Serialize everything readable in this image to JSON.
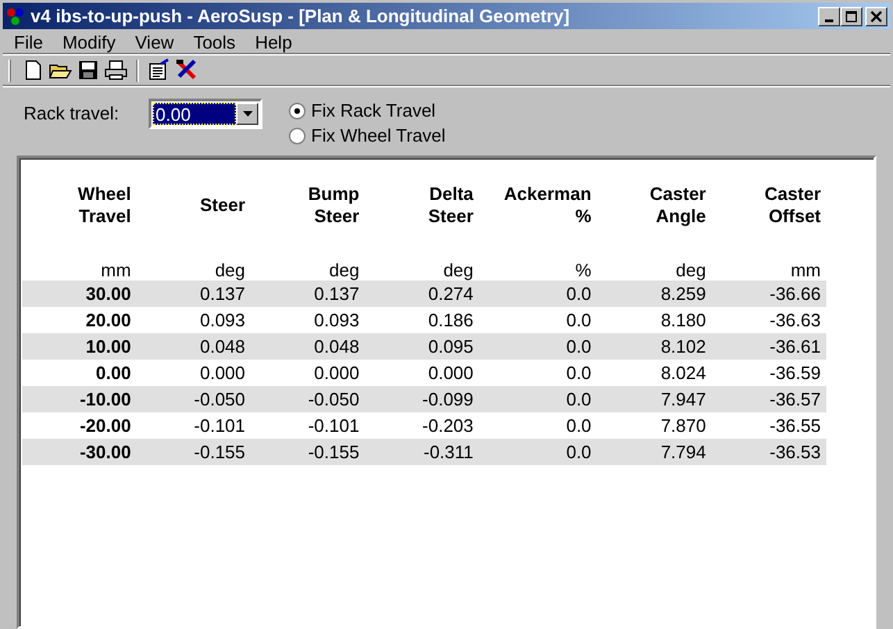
{
  "window": {
    "title": "v4 ibs-to-up-push - AeroSusp - [Plan & Longitudinal Geometry]"
  },
  "menu": [
    "File",
    "Modify",
    "View",
    "Tools",
    "Help"
  ],
  "toolbar": [
    {
      "kind": "new"
    },
    {
      "kind": "open"
    },
    {
      "kind": "save"
    },
    {
      "kind": "print"
    },
    {
      "kind": "separator"
    },
    {
      "kind": "properties"
    },
    {
      "kind": "tools"
    }
  ],
  "rack_travel": {
    "label": "Rack travel:",
    "value": "0.00"
  },
  "fix_options": [
    {
      "label": "Fix Rack Travel",
      "selected": true
    },
    {
      "label": "Fix Wheel Travel",
      "selected": false
    }
  ],
  "table": {
    "columns": [
      {
        "heading": [
          "Wheel",
          "Travel"
        ],
        "unit": "mm"
      },
      {
        "heading": [
          "Steer"
        ],
        "unit": "deg"
      },
      {
        "heading": [
          "Bump",
          "Steer"
        ],
        "unit": "deg"
      },
      {
        "heading": [
          "Delta",
          "Steer"
        ],
        "unit": "deg"
      },
      {
        "heading": [
          "Ackerman",
          "%"
        ],
        "unit": "%"
      },
      {
        "heading": [
          "Caster",
          "Angle"
        ],
        "unit": "deg"
      },
      {
        "heading": [
          "Caster",
          "Offset"
        ],
        "unit": "mm"
      }
    ],
    "rows": [
      [
        "30.00",
        "0.137",
        "0.137",
        "0.274",
        "0.0",
        "8.259",
        "-36.66"
      ],
      [
        "20.00",
        "0.093",
        "0.093",
        "0.186",
        "0.0",
        "8.180",
        "-36.63"
      ],
      [
        "10.00",
        "0.048",
        "0.048",
        "0.095",
        "0.0",
        "8.102",
        "-36.61"
      ],
      [
        "0.00",
        "0.000",
        "0.000",
        "0.000",
        "0.0",
        "8.024",
        "-36.59"
      ],
      [
        "-10.00",
        "-0.050",
        "-0.050",
        "-0.099",
        "0.0",
        "7.947",
        "-36.57"
      ],
      [
        "-20.00",
        "-0.101",
        "-0.101",
        "-0.203",
        "0.0",
        "7.870",
        "-36.55"
      ],
      [
        "-30.00",
        "-0.155",
        "-0.155",
        "-0.311",
        "0.0",
        "7.794",
        "-36.53"
      ]
    ]
  }
}
